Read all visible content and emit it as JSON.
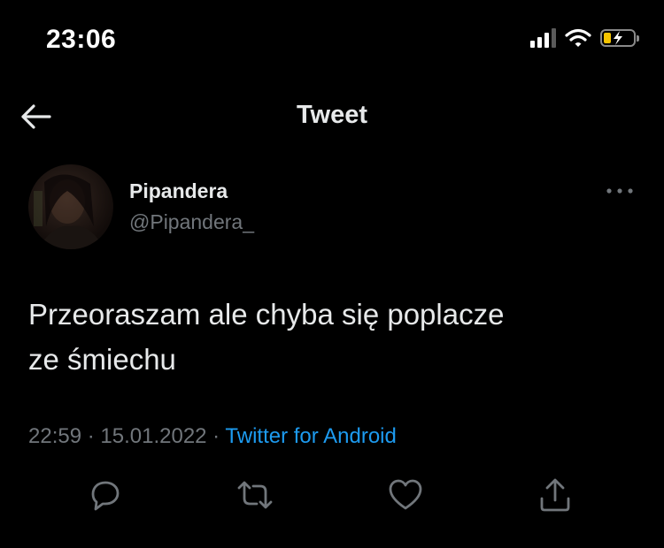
{
  "status_bar": {
    "time": "23:06",
    "signal_icon": "cellular-signal-icon",
    "wifi_icon": "wifi-icon",
    "battery_icon": "battery-charging-icon",
    "battery_color": "#f5c400"
  },
  "header": {
    "title": "Tweet",
    "back_icon": "back-arrow-icon"
  },
  "tweet": {
    "author_name": "Pipandera",
    "author_handle": "@Pipandera_",
    "text_line1": "Przeoraszam ale chyba się poplacze",
    "text_line2": "ze śmiechu",
    "time": "22:59",
    "separator1": " · ",
    "date": "15.01.2022",
    "separator2": " · ",
    "source": "Twitter for Android"
  },
  "actions": [
    {
      "name": "reply",
      "icon": "reply-icon"
    },
    {
      "name": "retweet",
      "icon": "retweet-icon"
    },
    {
      "name": "like",
      "icon": "heart-icon"
    },
    {
      "name": "share",
      "icon": "share-icon"
    }
  ],
  "colors": {
    "background": "#000000",
    "text": "#e7e9ea",
    "secondary": "#71767b",
    "link": "#1d9bf0"
  }
}
